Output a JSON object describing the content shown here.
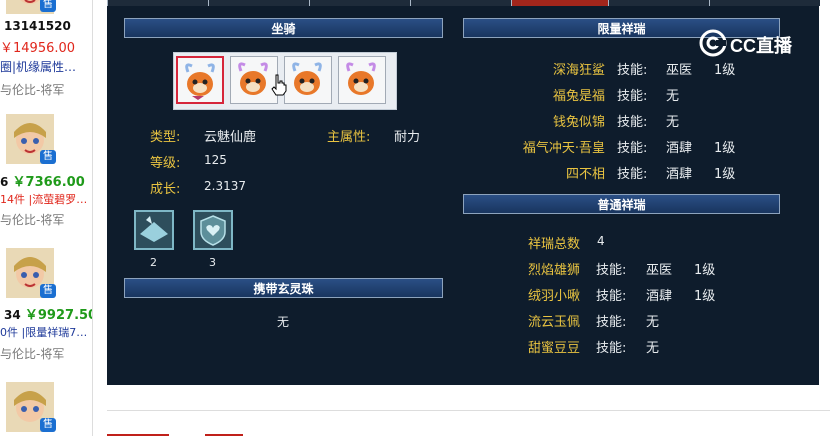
{
  "left_list": {
    "sell_label": "售",
    "entries": [
      {
        "line1": "13141520",
        "line2": "￥14956.00",
        "line3": "圈|机缘属性…",
        "line4": "与伦比-将军"
      },
      {
        "line1": "6 ",
        "price": "￥7366.00",
        "line2": "14件 |流萤碧罗…",
        "line3": "与伦比-将军"
      },
      {
        "line1": "34 ",
        "price": "￥9927.50",
        "line2": "0件 |限量祥瑞7…",
        "line3": "与伦比-将军"
      }
    ]
  },
  "mount": {
    "header": "坐骑",
    "type_label": "类型:",
    "type_value": "云魅仙鹿",
    "main_attr_label": "主属性:",
    "main_attr_value": "耐力",
    "level_label": "等级:",
    "level_value": "125",
    "growth_label": "成长:",
    "growth_value": "2.3137",
    "skills": [
      {
        "count": "2",
        "icon": "plate-skill-icon"
      },
      {
        "count": "3",
        "icon": "heart-shield-skill-icon"
      }
    ]
  },
  "orb": {
    "header": "携带玄灵珠",
    "value": "无"
  },
  "limited": {
    "header": "限量祥瑞",
    "skill_label": "技能:",
    "items": [
      {
        "name": "深海狂鲨",
        "skill": "巫医",
        "level": "1级"
      },
      {
        "name": "福兔是福",
        "skill": "无",
        "level": ""
      },
      {
        "name": "钱兔似锦",
        "skill": "无",
        "level": ""
      },
      {
        "name": "福气冲天·吾皇",
        "skill": "酒肆",
        "level": "1级"
      },
      {
        "name": "四不相",
        "skill": "酒肆",
        "level": "1级"
      }
    ]
  },
  "normal": {
    "header": "普通祥瑞",
    "total_label": "祥瑞总数",
    "total_value": "4",
    "skill_label": "技能:",
    "items": [
      {
        "name": "烈焰雄狮",
        "skill": "巫医",
        "level": "1级"
      },
      {
        "name": "绒羽小啾",
        "skill": "酒肆",
        "level": "1级"
      },
      {
        "name": "流云玉佩",
        "skill": "无",
        "level": ""
      },
      {
        "name": "甜蜜豆豆",
        "skill": "无",
        "level": ""
      }
    ]
  },
  "watermark": {
    "text": "CC直播"
  },
  "colors": {
    "panel_bg": "#0e1c2c",
    "label_gold": "#e8c341",
    "header_blue": "#2b4f85",
    "active_tab": "#a3261c"
  }
}
